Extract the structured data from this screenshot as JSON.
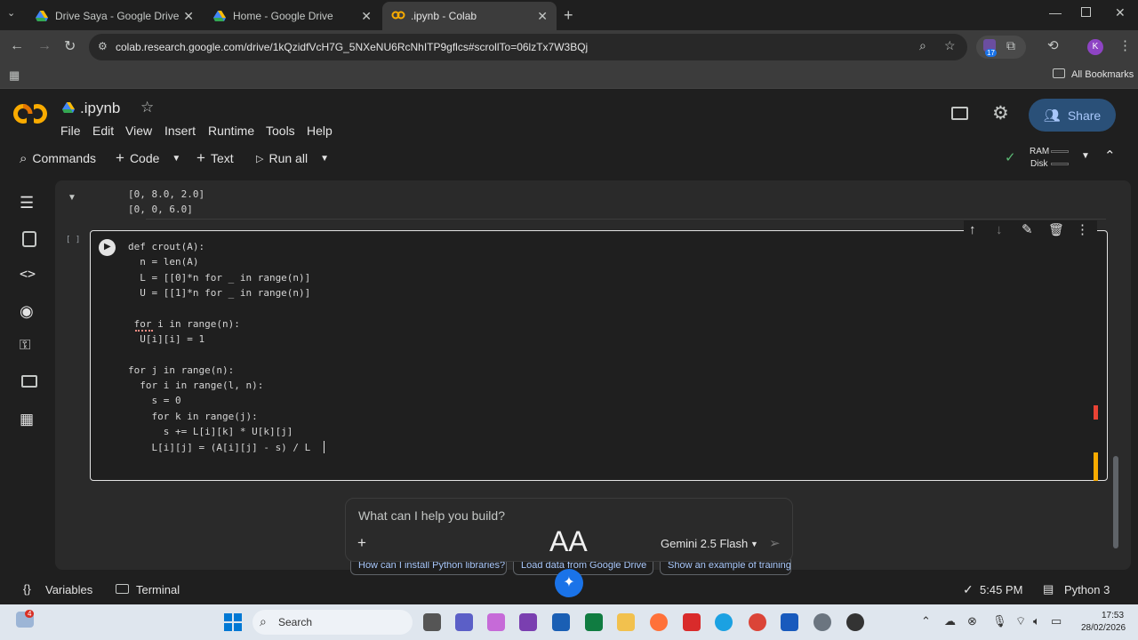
{
  "tabs": [
    {
      "title": "Drive Saya - Google Drive"
    },
    {
      "title": "Home - Google Drive"
    },
    {
      "title": ".ipynb - Colab"
    }
  ],
  "url": "colab.research.google.com/drive/1kQzidfVcH7G_5NXeNU6RcNhITP9gflcs#scrollTo=06lzTx7W3BQj",
  "extension_badge": "17",
  "profile_initial": "K",
  "bookmarks_label": "All Bookmarks",
  "notebook": {
    "title": ".ipynb",
    "menu": [
      "File",
      "Edit",
      "View",
      "Insert",
      "Runtime",
      "Tools",
      "Help"
    ],
    "share_label": "Share",
    "toolbar": {
      "commands": "Commands",
      "code": "Code",
      "text": "Text",
      "run_all": "Run all",
      "ram": "RAM",
      "disk": "Disk"
    },
    "prev_output": [
      "[0, 8.0, 2.0]",
      "[0, 0, 6.0]"
    ],
    "cell_bracket": "[ ]",
    "code_lines": [
      "def crout(A):",
      "  n = len(A)",
      "  L = [[0]*n for _ in range(n)]",
      "  U = [[1]*n for _ in range(n)]",
      "",
      " for i in range(n):",
      "  U[i][i] = 1",
      "",
      "for j in range(n):",
      "  for i in range(l, n):",
      "    s = 0",
      "    for k in range(j):",
      "      s += L[i][k] * U[k][j]",
      "    L[i][j] = (A[i][j] - s) / L"
    ],
    "suggestions": [
      "How can I install Python libraries?",
      "Load data from Google Drive",
      "Show an example of training a"
    ],
    "gemini": {
      "placeholder": "What can I help you build?",
      "model": "Gemini 2.5 Flash",
      "overlay_text": "AA"
    },
    "status": {
      "variables": "Variables",
      "terminal": "Terminal",
      "time": "5:45 PM",
      "kernel": "Python 3"
    }
  },
  "taskbar": {
    "search": "Search",
    "time": "17:53",
    "date": "28/02/2026",
    "notif_badge": "4"
  }
}
